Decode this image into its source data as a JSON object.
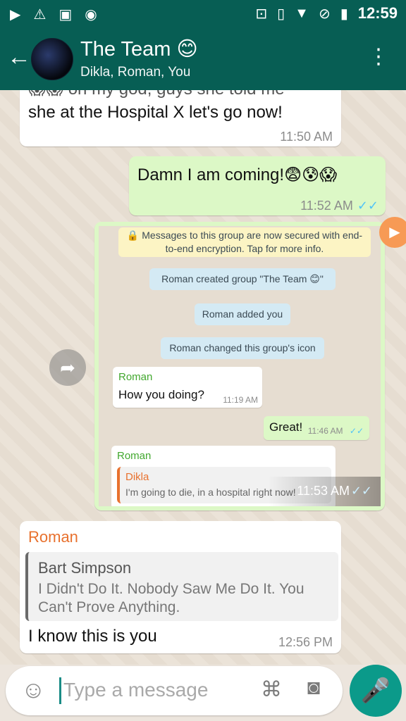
{
  "status_bar": {
    "time": "12:59",
    "left_icons": [
      "video-icon",
      "alert-icon",
      "image-icon",
      "cat-icon"
    ],
    "right_icons": [
      "cast-icon",
      "vibrate-icon",
      "wifi-icon",
      "no-sim-icon",
      "battery-icon"
    ]
  },
  "header": {
    "title": "The Team 😊",
    "subtitle": "Dikla, Roman, You"
  },
  "messages": {
    "m1": {
      "partial_top": "😱😱 oh my god, guys she told me",
      "text": "she at the Hospital X let's go now!",
      "time": "11:50 AM"
    },
    "m2": {
      "text": "Damn I am coming!😨😰😱",
      "time": "11:52 AM",
      "ticks": "✓✓"
    },
    "m3": {
      "time": "11:53 AM",
      "ticks": "✓✓",
      "screenshot": {
        "encryption": "🔒 Messages to this group are now secured with end-to-end encryption. Tap for more info.",
        "created": "Roman created group \"The Team 😊\"",
        "added": "Roman added you",
        "changed_icon": "Roman changed this group's icon",
        "b1_name": "Roman",
        "b1_text": "How you doing?",
        "b1_time": "11:19 AM",
        "b2_text": "Great!",
        "b2_time": "11:46 AM",
        "b2_ticks": "✓✓",
        "b3_name": "Roman",
        "b3_quote_name": "Dikla",
        "b3_quote_text": "I'm going to die, in a hospital right now!"
      }
    },
    "m4": {
      "sender": "Roman",
      "quote_author": "Bart Simpson",
      "quote_text": "I Didn't Do It. Nobody Saw Me Do It. You Can't Prove Anything.",
      "text": "I know this is you",
      "time": "12:56 PM"
    }
  },
  "composer": {
    "placeholder": "Type a message"
  },
  "colors": {
    "header": "#075e54",
    "outgoing_bubble": "#dcf8c6",
    "incoming_bubble": "#ffffff",
    "accent": "#0b9a8a",
    "sender_name": "#e8712e"
  }
}
